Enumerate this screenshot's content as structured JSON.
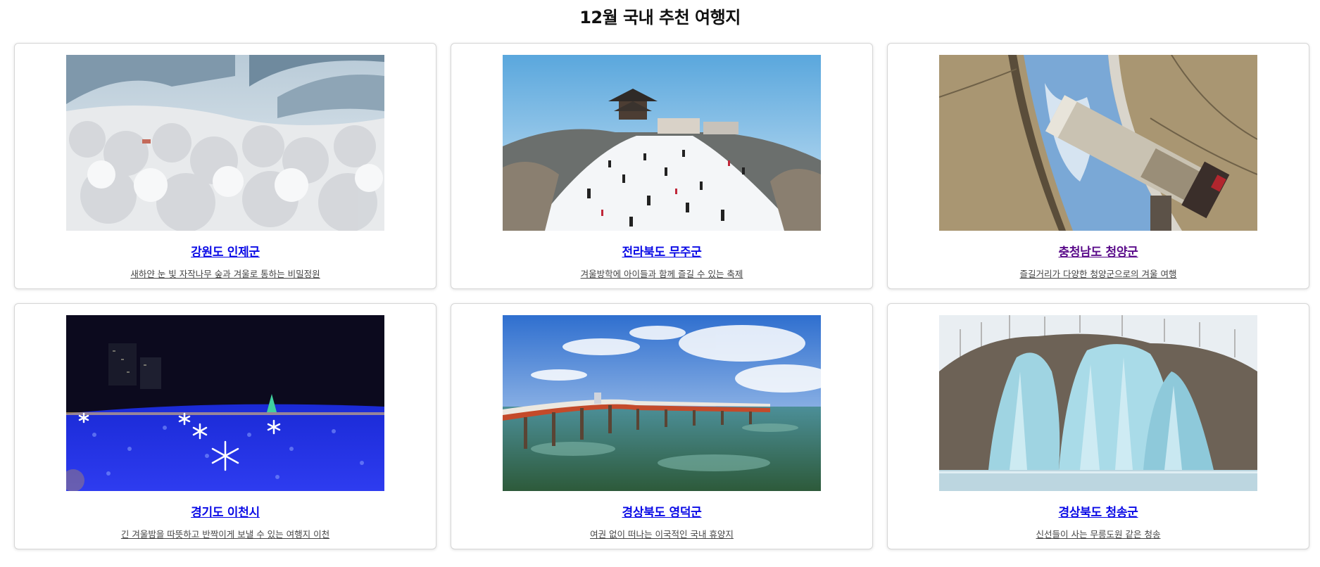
{
  "page": {
    "title": "12월 국내 추천 여행지"
  },
  "colors": {
    "link": "#0a0ae6",
    "visited_link": "#5a0b8a",
    "description": "#444444",
    "card_border": "#d6d6d6"
  },
  "destinations": [
    {
      "title": "강원도 인제군",
      "description": "새하얀 눈 빛 자작나무 숲과 겨울로 통하는 비밀정원",
      "image": "snowy-birch-forest"
    },
    {
      "title": "전라북도 무주군",
      "description": "겨울방학에 아이들과 함께 즐길 수 있는 축제",
      "image": "ski-mountain-pavilion"
    },
    {
      "title": "충청남도 청양군",
      "description": "즐길거리가 다양한 청양군으로의 겨울 여행",
      "image": "observatory-telescope"
    },
    {
      "title": "경기도 이천시",
      "description": "긴 겨울밤을 따뜻하고 반짝이게 보낼 수 있는 여행지 이천",
      "image": "blue-light-festival"
    },
    {
      "title": "경상북도 영덕군",
      "description": "여권 없이 떠나는 이국적인 국내 휴양지",
      "image": "seaside-pier"
    },
    {
      "title": "경상북도 청송군",
      "description": "신선들이 사는 무릉도원 같은 청송",
      "image": "frozen-ice-waterfall"
    }
  ]
}
